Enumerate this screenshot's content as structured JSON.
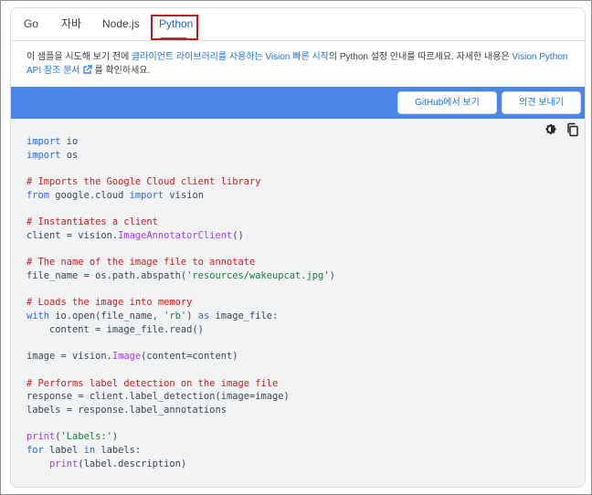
{
  "tabs": [
    {
      "label": "Go",
      "active": false
    },
    {
      "label": "자바",
      "active": false
    },
    {
      "label": "Node.js",
      "active": false
    },
    {
      "label": "Python",
      "active": true
    }
  ],
  "intro": {
    "prefix": "이 샘플을 시도해 보기 전에 ",
    "quickstart_link": "클라이언트 라이브러리를 사용하는 Vision 빠른 시작",
    "middle": "의 Python 설정 안내를 따르세요. 자세한 내용은 ",
    "api_link": "Vision Python API 참조 문서",
    "suffix": "를 확인하세요."
  },
  "actions": {
    "github_button": "GitHub에서 보기",
    "feedback_button": "의견 보내기"
  },
  "code_toolbar": {
    "theme_icon": "dark-mode-icon",
    "copy_icon": "copy-icon"
  },
  "code": {
    "l1_kw": "import",
    "l1_rest": " io",
    "l2_kw": "import",
    "l2_rest": " os",
    "l4_cm": "# Imports the Google Cloud client library",
    "l5_kw1": "from",
    "l5_mid": " google.cloud ",
    "l5_kw2": "import",
    "l5_rest": " vision",
    "l7_cm": "# Instantiates a client",
    "l8_pre": "client = vision.",
    "l8_fn": "ImageAnnotatorClient",
    "l8_post": "()",
    "l10_cm": "# The name of the image file to annotate",
    "l11_pre": "file_name = os.path.abspath(",
    "l11_st": "'resources/wakeupcat.jpg'",
    "l11_post": ")",
    "l13_cm": "# Loads the image into memory",
    "l14_kw": "with",
    "l14_mid": " io.open(file_name, ",
    "l14_st": "'rb'",
    "l14_mid2": ") ",
    "l14_kw2": "as",
    "l14_post": " image_file:",
    "l15": "    content = image_file.read()",
    "l17_pre": "image = vision.",
    "l17_fn": "Image",
    "l17_post": "(content=content)",
    "l19_cm": "# Performs label detection on the image file",
    "l20": "response = client.label_detection(image=image)",
    "l21": "labels = response.label_annotations",
    "l23_fn": "print",
    "l23_mid": "(",
    "l23_st": "'Labels:'",
    "l23_post": ")",
    "l24_kw": "for",
    "l24_mid": " label ",
    "l24_kw2": "in",
    "l24_post": " labels:",
    "l25_pre": "    ",
    "l25_fn": "print",
    "l25_post": "(label.description)"
  },
  "colors": {
    "accent": "#1a73e8",
    "action_bar": "#4a86e8",
    "highlight_box": "#b32121"
  }
}
